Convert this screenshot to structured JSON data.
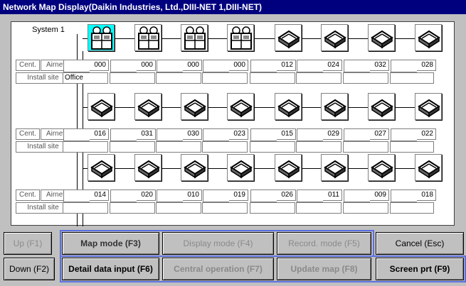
{
  "window": {
    "title": "Network Map Display(Daikin Industries, Ltd.,DIII-NET 1,DIII-NET)"
  },
  "map": {
    "system_label": "System 1",
    "rows": [
      {
        "cent_label": "Cent.",
        "airnet_label": "Airnet",
        "install_label": "Install site",
        "units": [
          {
            "type": "outdoor-unit-icon",
            "address": "000",
            "site": "Office",
            "selected": true
          },
          {
            "type": "outdoor-unit-icon",
            "address": "000",
            "site": ""
          },
          {
            "type": "outdoor-unit-icon",
            "address": "000",
            "site": ""
          },
          {
            "type": "outdoor-unit-icon",
            "address": "000",
            "site": ""
          },
          {
            "type": "cassette-unit-icon",
            "address": "012",
            "site": ""
          },
          {
            "type": "cassette-unit-icon",
            "address": "024",
            "site": ""
          },
          {
            "type": "cassette-unit-icon",
            "address": "032",
            "site": ""
          },
          {
            "type": "cassette-unit-icon",
            "address": "028",
            "site": ""
          }
        ]
      },
      {
        "cent_label": "Cent.",
        "airnet_label": "Airnet",
        "install_label": "Install site",
        "units": [
          {
            "type": "cassette-unit-icon",
            "address": "016",
            "site": ""
          },
          {
            "type": "cassette-unit-icon",
            "address": "031",
            "site": ""
          },
          {
            "type": "cassette-unit-icon",
            "address": "030",
            "site": ""
          },
          {
            "type": "cassette-unit-icon",
            "address": "023",
            "site": ""
          },
          {
            "type": "cassette-unit-icon",
            "address": "015",
            "site": ""
          },
          {
            "type": "cassette-unit-icon",
            "address": "029",
            "site": ""
          },
          {
            "type": "cassette-unit-icon",
            "address": "027",
            "site": ""
          },
          {
            "type": "cassette-unit-icon",
            "address": "022",
            "site": ""
          }
        ]
      },
      {
        "cent_label": "Cent.",
        "airnet_label": "Airnet",
        "install_label": "Install site",
        "units": [
          {
            "type": "cassette-unit-icon",
            "address": "014",
            "site": ""
          },
          {
            "type": "cassette-unit-icon",
            "address": "020",
            "site": ""
          },
          {
            "type": "cassette-unit-icon",
            "address": "010",
            "site": ""
          },
          {
            "type": "cassette-unit-icon",
            "address": "019",
            "site": ""
          },
          {
            "type": "cassette-unit-icon",
            "address": "026",
            "site": ""
          },
          {
            "type": "cassette-unit-icon",
            "address": "011",
            "site": ""
          },
          {
            "type": "cassette-unit-icon",
            "address": "009",
            "site": ""
          },
          {
            "type": "cassette-unit-icon",
            "address": "018",
            "site": ""
          }
        ]
      }
    ]
  },
  "buttons": {
    "up": "Up (F1)",
    "down": "Down (F2)",
    "map_mode": "Map mode (F3)",
    "display_mode": "Display mode (F4)",
    "record_mode": "Record. mode (F5)",
    "cancel": "Cancel (Esc)",
    "detail_input": "Detail data input (F6)",
    "central_op": "Central operation (F7)",
    "update_map": "Update map (F8)",
    "screen_prt": "Screen prt (F9)"
  }
}
